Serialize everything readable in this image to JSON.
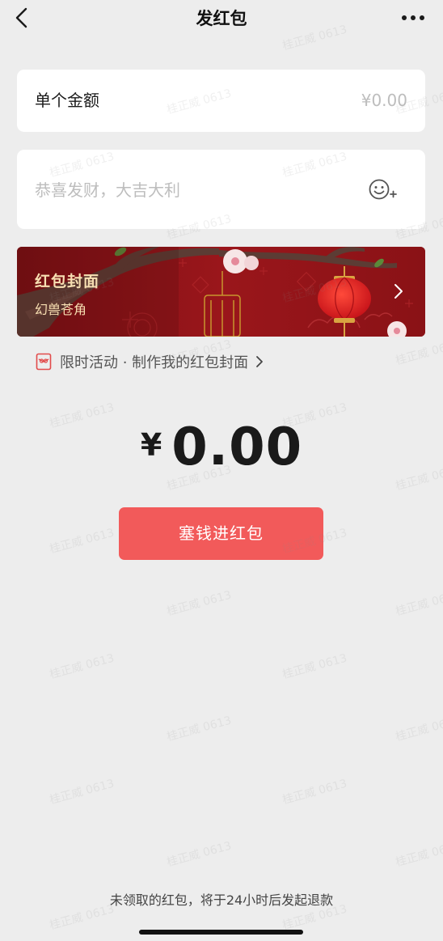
{
  "header": {
    "title": "发红包"
  },
  "amount": {
    "label": "单个金额",
    "placeholder": "¥0.00"
  },
  "greeting": {
    "placeholder": "恭喜发财，大吉大利"
  },
  "cover": {
    "title": "红包封面",
    "name": "幻兽苍角"
  },
  "promo": {
    "text": "限时活动 · 制作我的红包封面"
  },
  "total": {
    "currency": "¥",
    "value": "0.00"
  },
  "submit": {
    "label": "塞钱进红包"
  },
  "footer": {
    "note": "未领取的红包，将于24小时后发起退款"
  },
  "watermark": {
    "text": "桂正威 0613"
  },
  "colors": {
    "background": "#ededed",
    "accent_red": "#f25a5a",
    "cover_red": "#8f1418",
    "cover_text": "#f7dfb2"
  },
  "icons": {
    "back": "chevron-left-icon",
    "more": "more-dots-icon",
    "emoji": "emoji-add-icon",
    "cover_arrow": "chevron-right-icon",
    "promo": "gift-card-icon"
  }
}
